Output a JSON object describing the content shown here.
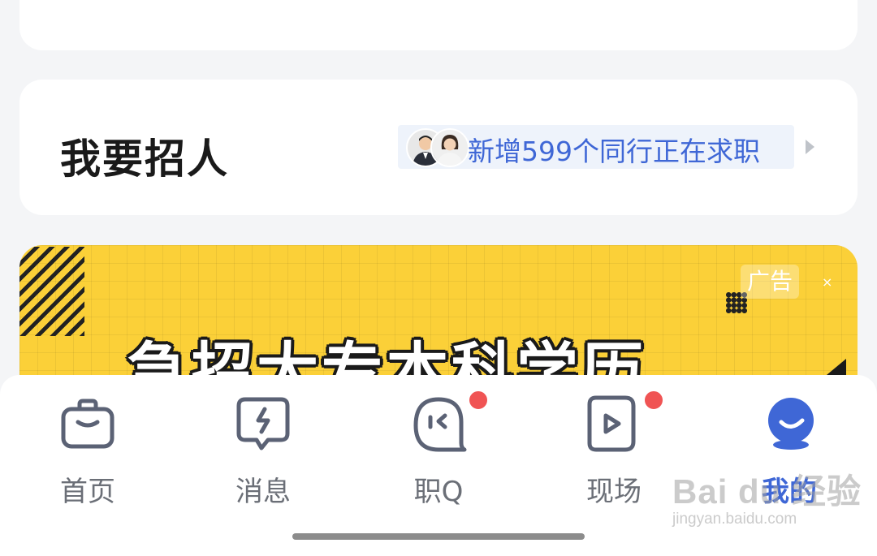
{
  "recruit": {
    "title": "我要招人",
    "tag_text": "新增599个同行正在求职"
  },
  "banner": {
    "ad_label": "广告",
    "close_glyph": "×",
    "headline": "急招大专本科学历"
  },
  "tabbar": {
    "items": [
      {
        "label": "首页",
        "icon": "briefcase-icon",
        "badge": false,
        "active": false
      },
      {
        "label": "消息",
        "icon": "message-icon",
        "badge": false,
        "active": false
      },
      {
        "label": "职Q",
        "icon": "chat-bubble-icon",
        "badge": true,
        "active": false
      },
      {
        "label": "现场",
        "icon": "play-icon",
        "badge": true,
        "active": false
      },
      {
        "label": "我的",
        "icon": "profile-icon",
        "badge": false,
        "active": true
      }
    ]
  },
  "watermark": {
    "logo": "Bai du 经验",
    "url": "jingyan.baidu.com"
  },
  "colors": {
    "accent": "#3f67d6",
    "icon": "#5b6275",
    "badge": "#f05454",
    "banner": "#fbd038"
  }
}
